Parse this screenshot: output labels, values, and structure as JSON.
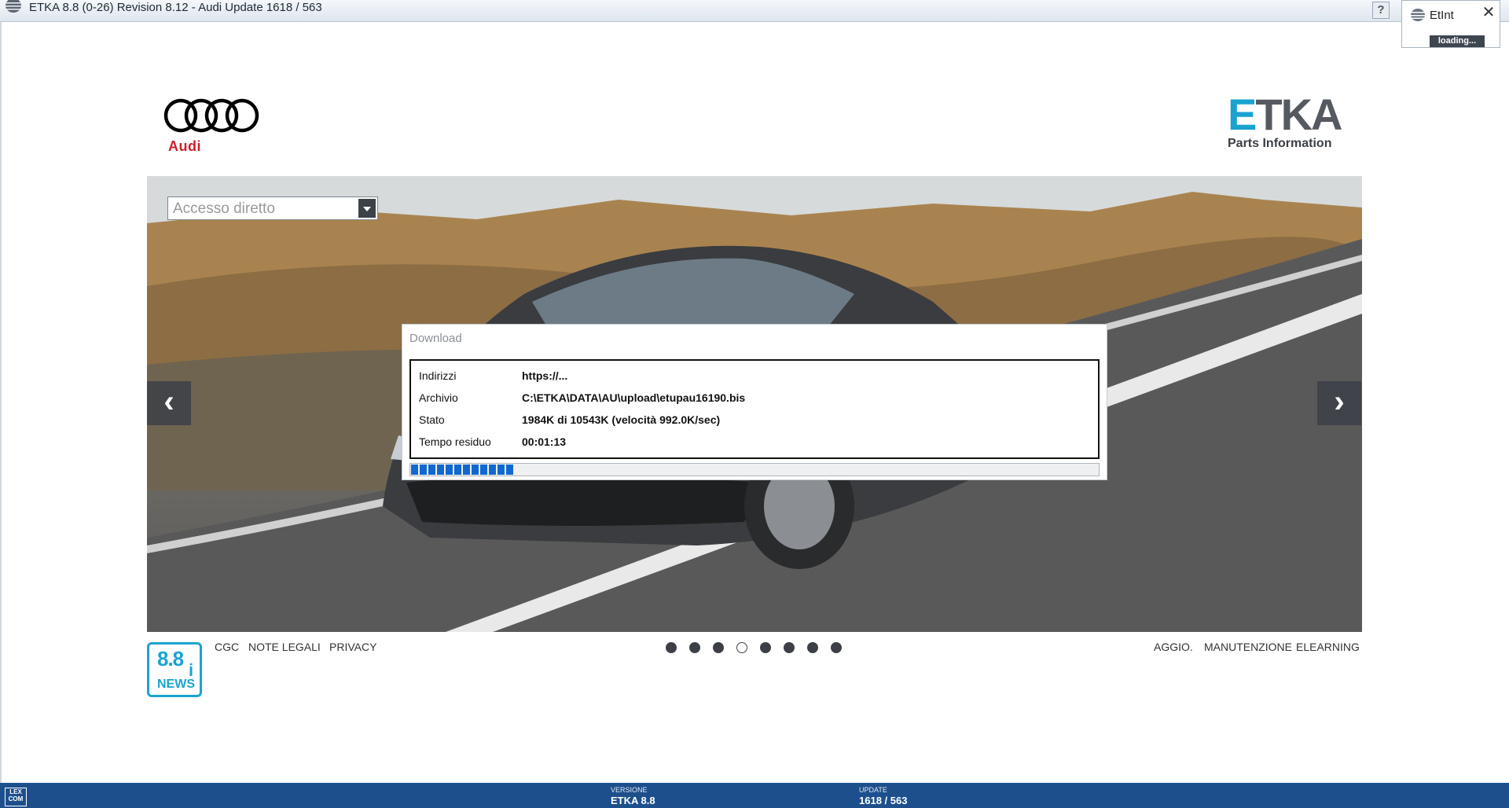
{
  "window": {
    "title": "ETKA 8.8 (0-26) Revision 8.12 - Audi Update 1618 / 563",
    "help_label": "?"
  },
  "etint_popup": {
    "title": "EtInt",
    "close_label": "✕",
    "loading_text": "loading..."
  },
  "brand": {
    "audi_text": "Audi",
    "etka_word_first": "E",
    "etka_word_rest": "TKA",
    "etka_subtitle": "Parts Information"
  },
  "direct_access": {
    "placeholder": "Accesso diretto"
  },
  "carousel": {
    "prev_label": "‹",
    "next_label": "›",
    "slide_count": 8,
    "active_slide_index": 3
  },
  "download_dialog": {
    "title": "Download",
    "rows": [
      {
        "label": "Indirizzi",
        "value": "https://..."
      },
      {
        "label": "Archivio",
        "value": "C:\\ETKA\\DATA\\AU\\upload\\etupau16190.bis"
      },
      {
        "label": "Stato",
        "value": "1984K di 10543K (velocità 992.0K/sec)"
      },
      {
        "label": "Tempo residuo",
        "value": "00:01:13"
      }
    ],
    "progress_fraction": 0.15
  },
  "news_badge": {
    "version": "8.8",
    "i": "i",
    "word": "NEWS"
  },
  "footer_links_left": [
    "CGC",
    "NOTE LEGALI",
    "PRIVACY"
  ],
  "footer_links_right": [
    "AGGIO.",
    "MANUTENZIONE",
    "ELEARNING"
  ],
  "statusbar": {
    "logo_text_top": "LEX",
    "logo_text_bottom": "COM",
    "version_caption": "VERSIONE",
    "version_value": "ETKA 8.8",
    "update_caption": "UPDATE",
    "update_value": "1618 / 563"
  },
  "colors": {
    "etka_accent": "#1aa3d1",
    "audi_red": "#cc1e2b",
    "statusbar_blue": "#1d4f8c",
    "progress_blue": "#1168d1"
  }
}
